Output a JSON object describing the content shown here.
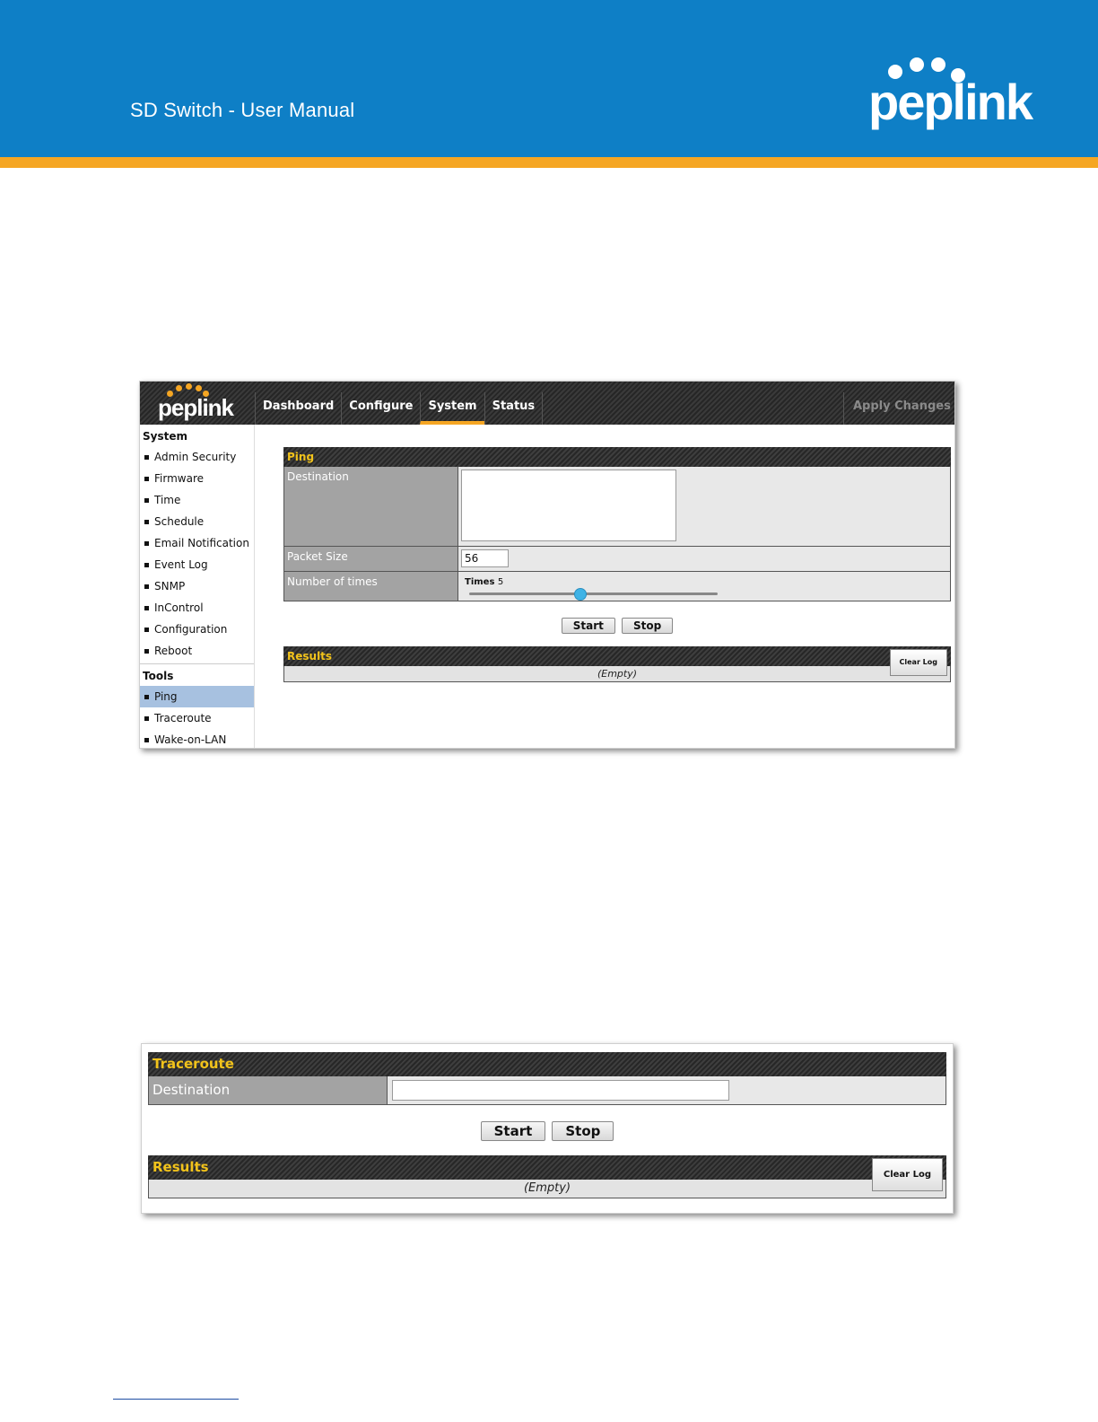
{
  "doc": {
    "title": "SD Switch  - User Manual",
    "brand": "peplink",
    "brand_color": "#0e7fc6",
    "accent_color": "#f5a623"
  },
  "app": {
    "logo": "peplink",
    "nav": [
      "Dashboard",
      "Configure",
      "System",
      "Status"
    ],
    "active_nav": "System",
    "apply_label": "Apply Changes",
    "sidebar": {
      "system_heading": "System",
      "system_items": [
        "Admin Security",
        "Firmware",
        "Time",
        "Schedule",
        "Email Notification",
        "Event Log",
        "SNMP",
        "InControl",
        "Configuration",
        "Reboot"
      ],
      "tools_heading": "Tools",
      "tools_items": [
        "Ping",
        "Traceroute",
        "Wake-on-LAN"
      ],
      "active_item": "Ping"
    }
  },
  "ping": {
    "title": "Ping",
    "destination_label": "Destination",
    "destination_value": "",
    "packet_size_label": "Packet Size",
    "packet_size_value": "56",
    "times_label": "Number of times",
    "times_caption": "Times",
    "times_value": "5",
    "start_label": "Start",
    "stop_label": "Stop",
    "results_title": "Results",
    "clear_log_label": "Clear Log",
    "results_empty": "(Empty)"
  },
  "traceroute": {
    "title": "Traceroute",
    "destination_label": "Destination",
    "destination_value": "",
    "start_label": "Start",
    "stop_label": "Stop",
    "results_title": "Results",
    "clear_log_label": "Clear Log",
    "results_empty": "(Empty)"
  }
}
